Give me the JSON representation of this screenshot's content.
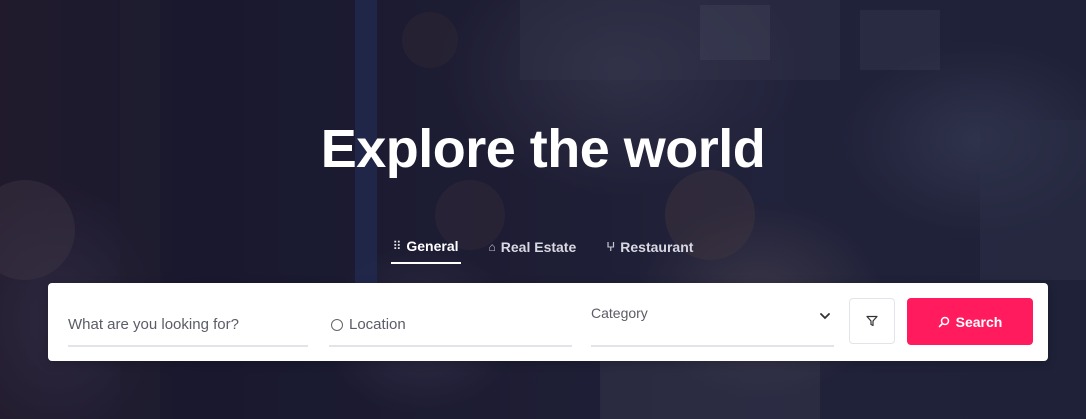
{
  "hero": {
    "title": "Explore the world"
  },
  "tabs": [
    {
      "label": "General",
      "icon": "grid-icon",
      "active": true
    },
    {
      "label": "Real Estate",
      "icon": "home-icon",
      "active": false
    },
    {
      "label": "Restaurant",
      "icon": "utensils-icon",
      "active": false
    }
  ],
  "search": {
    "keyword_placeholder": "What are you looking for?",
    "location_placeholder": "Location",
    "category_label": "Category",
    "filter_icon": "filter-icon",
    "search_label": "Search",
    "search_icon": "search-icon"
  },
  "colors": {
    "accent": "#ff1b5e",
    "card": "#ffffff",
    "title": "#ffffff"
  }
}
